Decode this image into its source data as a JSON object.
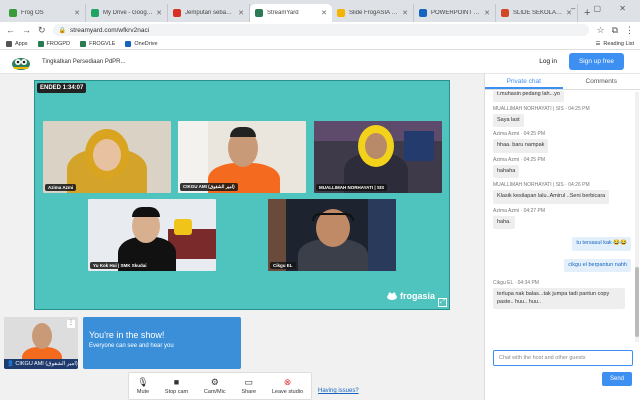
{
  "browser": {
    "tabs": [
      {
        "label": "Frog OS",
        "color": "#3a9b3c"
      },
      {
        "label": "My Drive - Google Dri...",
        "color": "#1fa463"
      },
      {
        "label": "Jemputan sebagai Or...",
        "color": "#d93025"
      },
      {
        "label": "StreamYard",
        "color": "#2a7a53"
      },
      {
        "label": "Slide FrogASIA dan F...",
        "color": "#f4b400"
      },
      {
        "label": "POWERPOINT - OneD...",
        "color": "#1565c0"
      },
      {
        "label": "SLIDE SEKOLAH.pptx",
        "color": "#d24726"
      }
    ],
    "url": "streamyard.com/wfkrv2naci",
    "bookmarks": [
      {
        "label": "Apps",
        "color": "#555555"
      },
      {
        "label": "FROGPD",
        "color": "#2a7a53"
      },
      {
        "label": "FROGVLE",
        "color": "#2a7a53"
      },
      {
        "label": "OneDrive",
        "color": "#1565c0"
      }
    ],
    "reading_list": "Reading List"
  },
  "header": {
    "title": "Tingkatkan Persediaan PdPR...",
    "login": "Log in",
    "signup": "Sign up free"
  },
  "stage": {
    "ended_label": "ENDED 1:34:07",
    "brand": "frogasia",
    "participants": [
      {
        "name": "Azima Azmi"
      },
      {
        "name": "CIKGU AMI (امير الشقوق)"
      },
      {
        "name": "MUALLIMAH NORHAYATI | SIS"
      },
      {
        "name": "Yu Kok Hui | SMK Skudai"
      },
      {
        "name": "Cikgu EL"
      }
    ]
  },
  "self": {
    "name": "CIKGU AMI (امير الشقوق)",
    "in_show_title": "You're in the show!",
    "in_show_sub": "Everyone can see and hear you"
  },
  "toolbar": {
    "mute": "Mute",
    "stop_cam": "Stop cam",
    "cam_mic": "Cam/Mic",
    "share": "Share",
    "leave": "Leave studio",
    "issues": "Having issues?"
  },
  "chat": {
    "tab_private": "Private chat",
    "tab_comments": "Comments",
    "top_fragment": "t.muhasin pedang lah...yo",
    "messages": [
      {
        "author": "MUALLIMAH NORHAYATI | SIS",
        "time": "04:25 PM",
        "text": "Saya last"
      },
      {
        "author": "Azima Azmi",
        "time": "04:25 PM",
        "text": "hhaa. baru nampak"
      },
      {
        "author": "Azima Azmi",
        "time": "04:25 PM",
        "text": "hahaha"
      },
      {
        "author": "MUALLIMAH NORHAYATI | SIS",
        "time": "04:26 PM",
        "text": "Klasik kesilapan lalu..Amirul ..Seni berbicara"
      },
      {
        "author": "Azima Azmi",
        "time": "04:27 PM",
        "text": "haha."
      }
    ],
    "outgoing": [
      {
        "text": "tu tersasul kak 😂😂"
      },
      {
        "text": "cikgu el berpantun nahh"
      }
    ],
    "last": {
      "author": "Cikgu EL",
      "time": "04:34 PM",
      "text": "terlupa nak balas...tak jumpa tadi pantun copy paste.. huu.. huu.."
    },
    "input_placeholder": "Chat with the host and other guests",
    "send": "Send"
  }
}
